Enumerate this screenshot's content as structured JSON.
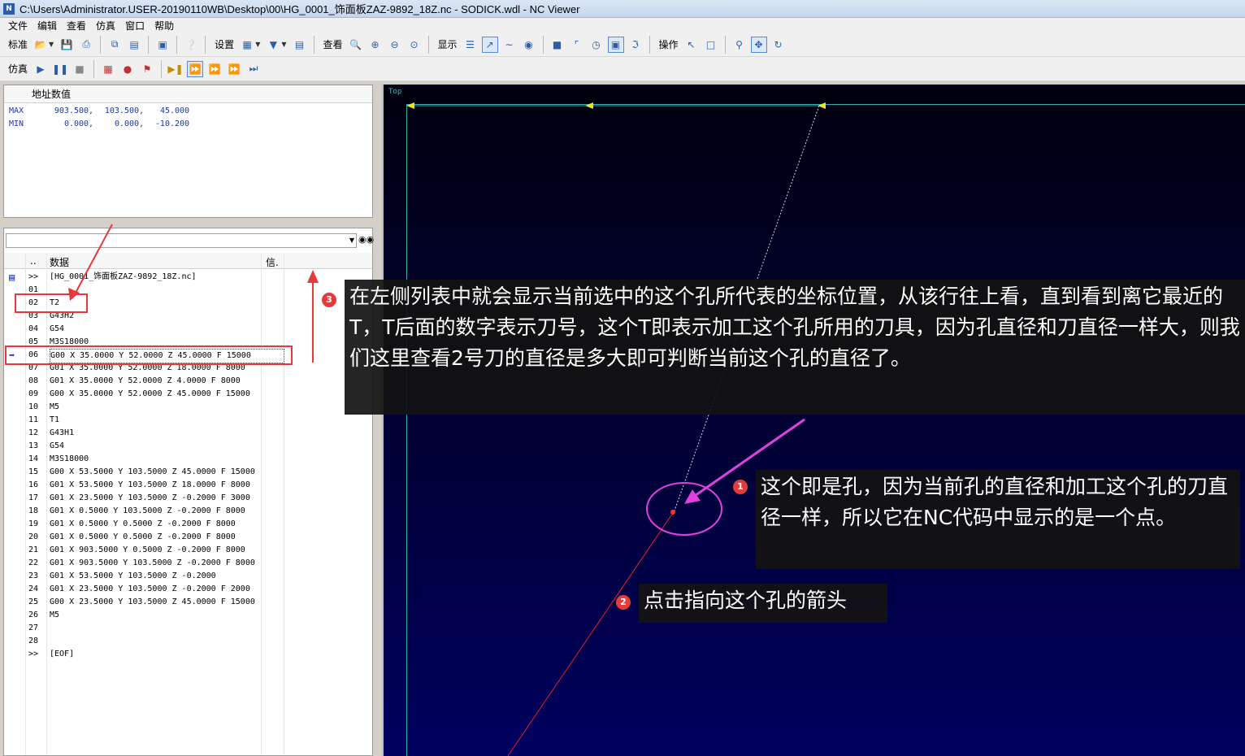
{
  "window": {
    "title": "C:\\Users\\Administrator.USER-20190110WB\\Desktop\\00\\HG_0001_饰面板ZAZ-9892_18Z.nc - SODICK.wdl - NC Viewer",
    "icon": "N"
  },
  "menu": [
    "文件",
    "编辑",
    "查看",
    "仿真",
    "窗口",
    "帮助"
  ],
  "toolbar1": {
    "standard_label": "标准",
    "settings_label": "设置",
    "view_label": "查看",
    "display_label": "显示",
    "operate_label": "操作"
  },
  "toolbar2": {
    "sim_label": "仿真"
  },
  "address_panel": {
    "header": "地址数值",
    "rows": [
      {
        "label": "MAX",
        "x": "903.500,",
        "y": "103.500,",
        "z": "45.000"
      },
      {
        "label": "MIN",
        "x": "0.000,",
        "y": "0.000,",
        "z": "-10.200"
      }
    ]
  },
  "nc_panel": {
    "col_dots": "..",
    "col_data": "数据",
    "col_info": "信.",
    "find_icon": "binoculars-icon",
    "rows": [
      {
        "num": ">>",
        "code": "[HG_0001_饰面板ZAZ-9892_18Z.nc]",
        "marker": "doc"
      },
      {
        "num": "01",
        "code": ""
      },
      {
        "num": "02",
        "code": "T2"
      },
      {
        "num": "03",
        "code": "G43H2"
      },
      {
        "num": "04",
        "code": "G54"
      },
      {
        "num": "05",
        "code": "M3S18000"
      },
      {
        "num": "06",
        "code": "G00 X 35.0000 Y 52.0000 Z 45.0000 F 15000",
        "marker": "arrow",
        "current": true
      },
      {
        "num": "07",
        "code": "G01 X 35.0000 Y 52.0000 Z 18.0000 F 8000"
      },
      {
        "num": "08",
        "code": "G01 X 35.0000 Y 52.0000 Z 4.0000 F 8000"
      },
      {
        "num": "09",
        "code": "G00 X 35.0000 Y 52.0000 Z 45.0000 F 15000"
      },
      {
        "num": "10",
        "code": "M5"
      },
      {
        "num": "11",
        "code": "T1"
      },
      {
        "num": "12",
        "code": "G43H1"
      },
      {
        "num": "13",
        "code": "G54"
      },
      {
        "num": "14",
        "code": "M3S18000"
      },
      {
        "num": "15",
        "code": "G00 X 53.5000 Y 103.5000 Z 45.0000 F 15000"
      },
      {
        "num": "16",
        "code": "G01 X 53.5000 Y 103.5000 Z 18.0000 F 8000"
      },
      {
        "num": "17",
        "code": "G01 X 23.5000 Y 103.5000 Z -0.2000 F 3000"
      },
      {
        "num": "18",
        "code": "G01 X 0.5000 Y 103.5000 Z -0.2000 F 8000"
      },
      {
        "num": "19",
        "code": "G01 X 0.5000 Y 0.5000 Z -0.2000 F 8000"
      },
      {
        "num": "20",
        "code": "G01 X 0.5000 Y 0.5000 Z -0.2000 F 8000"
      },
      {
        "num": "21",
        "code": "G01 X 903.5000 Y 0.5000 Z -0.2000 F 8000"
      },
      {
        "num": "22",
        "code": "G01 X 903.5000 Y 103.5000 Z -0.2000 F 8000"
      },
      {
        "num": "23",
        "code": "G01 X 53.5000 Y 103.5000 Z -0.2000"
      },
      {
        "num": "24",
        "code": "G01 X 23.5000 Y 103.5000 Z -0.2000 F 2000"
      },
      {
        "num": "25",
        "code": "G00 X 23.5000 Y 103.5000 Z 45.0000 F 15000"
      },
      {
        "num": "26",
        "code": "M5"
      },
      {
        "num": "27",
        "code": ""
      },
      {
        "num": "28",
        "code": ""
      },
      {
        "num": ">>",
        "code": "[EOF]"
      }
    ]
  },
  "viewport": {
    "label": "Top"
  },
  "annotations": [
    {
      "badge": "1",
      "text": "这个即是孔，因为当前孔的直径和加工这个孔的刀直径一样，所以它在NC代码中显示的是一个点。"
    },
    {
      "badge": "2",
      "text": "点击指向这个孔的箭头"
    },
    {
      "badge": "3",
      "text": "在左侧列表中就会显示当前选中的这个孔所代表的坐标位置，从该行往上看，直到看到离它最近的T，T后面的数字表示刀号，这个T即表示加工这个孔所用的刀具，因为孔直径和刀直径一样大，则我们这里查看2号刀的直径是多大即可判断当前这个孔的直径了。"
    }
  ],
  "colors": {
    "highlight": "#e8383c",
    "magenta": "#e040e0",
    "viewport_bg": "#00003a",
    "frame": "#38a8a8"
  }
}
